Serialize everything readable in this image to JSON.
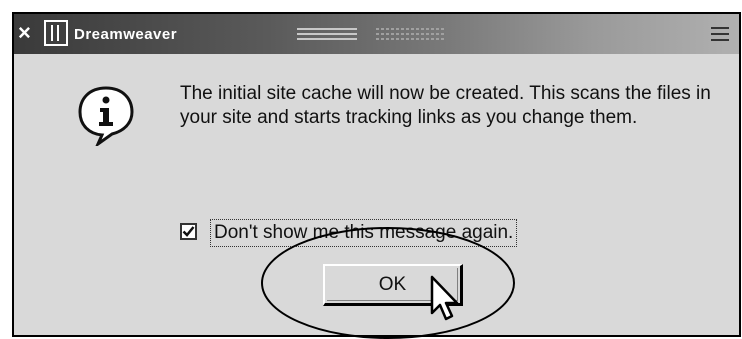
{
  "window": {
    "title": "Dreamweaver",
    "close_glyph": "×",
    "icons": [
      "close-icon",
      "dreamweaver-logo-icon",
      "menu-icon"
    ]
  },
  "dialog": {
    "icon": "info-icon",
    "message": "The initial site cache will now be created. This scans the files in your site and starts tracking links as you change them.",
    "checkbox": {
      "label": "Don't show me this message again.",
      "checked": true
    },
    "ok_label": "OK"
  },
  "annotation": {
    "highlight": "ellipse around OK button",
    "pointer": "mouse-cursor-icon"
  }
}
